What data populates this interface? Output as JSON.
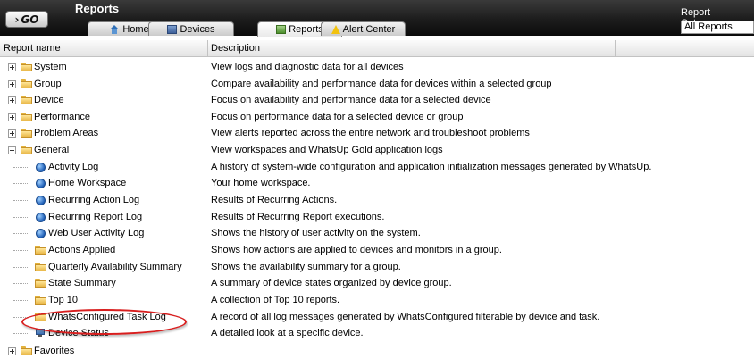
{
  "header": {
    "go_label": "GO",
    "title": "Reports",
    "category_label": "Report Category:",
    "category_value": "All Reports"
  },
  "tabs": [
    {
      "label": "Home",
      "icon": "home-icon",
      "active": false
    },
    {
      "label": "Devices",
      "icon": "devices-icon",
      "active": false
    },
    {
      "label": "Reports",
      "icon": "reports-icon",
      "active": true
    },
    {
      "label": "Alert Center",
      "icon": "alert-icon",
      "active": false
    }
  ],
  "columns": {
    "name": "Report name",
    "description": "Description"
  },
  "tree": [
    {
      "name": "System",
      "description": "View logs and diagnostic data for all devices",
      "type": "folder",
      "expanded": false
    },
    {
      "name": "Group",
      "description": "Compare availability and performance data for devices within a selected group",
      "type": "folder",
      "expanded": false
    },
    {
      "name": "Device",
      "description": "Focus on availability and performance data for a selected device",
      "type": "folder",
      "expanded": false
    },
    {
      "name": "Performance",
      "description": "Focus on performance data for a selected device or group",
      "type": "folder",
      "expanded": false
    },
    {
      "name": "Problem Areas",
      "description": "View alerts reported across the entire network and troubleshoot problems",
      "type": "folder",
      "expanded": false
    },
    {
      "name": "General",
      "description": "View workspaces and WhatsUp Gold application logs",
      "type": "folder",
      "expanded": true
    },
    {
      "name": "Activity Log",
      "description": "A history of system-wide configuration and application initialization messages generated by WhatsUp.",
      "type": "globe"
    },
    {
      "name": "Home Workspace",
      "description": "Your home workspace.",
      "type": "globe"
    },
    {
      "name": "Recurring Action Log",
      "description": "Results of Recurring Actions.",
      "type": "globe"
    },
    {
      "name": "Recurring Report Log",
      "description": "Results of Recurring Report executions.",
      "type": "globe"
    },
    {
      "name": "Web User Activity Log",
      "description": "Shows the history of user activity on the system.",
      "type": "globe"
    },
    {
      "name": "Actions Applied",
      "description": "Shows how actions are applied to devices and monitors in a group.",
      "type": "folder-leaf"
    },
    {
      "name": "Quarterly Availability Summary",
      "description": "Shows the availability summary for a group.",
      "type": "folder-leaf"
    },
    {
      "name": "State Summary",
      "description": "A summary of device states organized by device group.",
      "type": "folder-leaf"
    },
    {
      "name": "Top 10",
      "description": "A collection of Top 10 reports.",
      "type": "folder-leaf"
    },
    {
      "name": "WhatsConfigured Task Log",
      "description": "A record of all log messages generated by WhatsConfigured filterable by device and task.",
      "type": "folder-leaf",
      "highlighted": true
    },
    {
      "name": "Device Status",
      "description": "A detailed look at a specific device.",
      "type": "monitor"
    },
    {
      "name": "Favorites",
      "description": "",
      "type": "folder",
      "expanded": false
    }
  ],
  "colors": {
    "highlight": "#d81e1e",
    "topbar": "#1c1c1c"
  }
}
